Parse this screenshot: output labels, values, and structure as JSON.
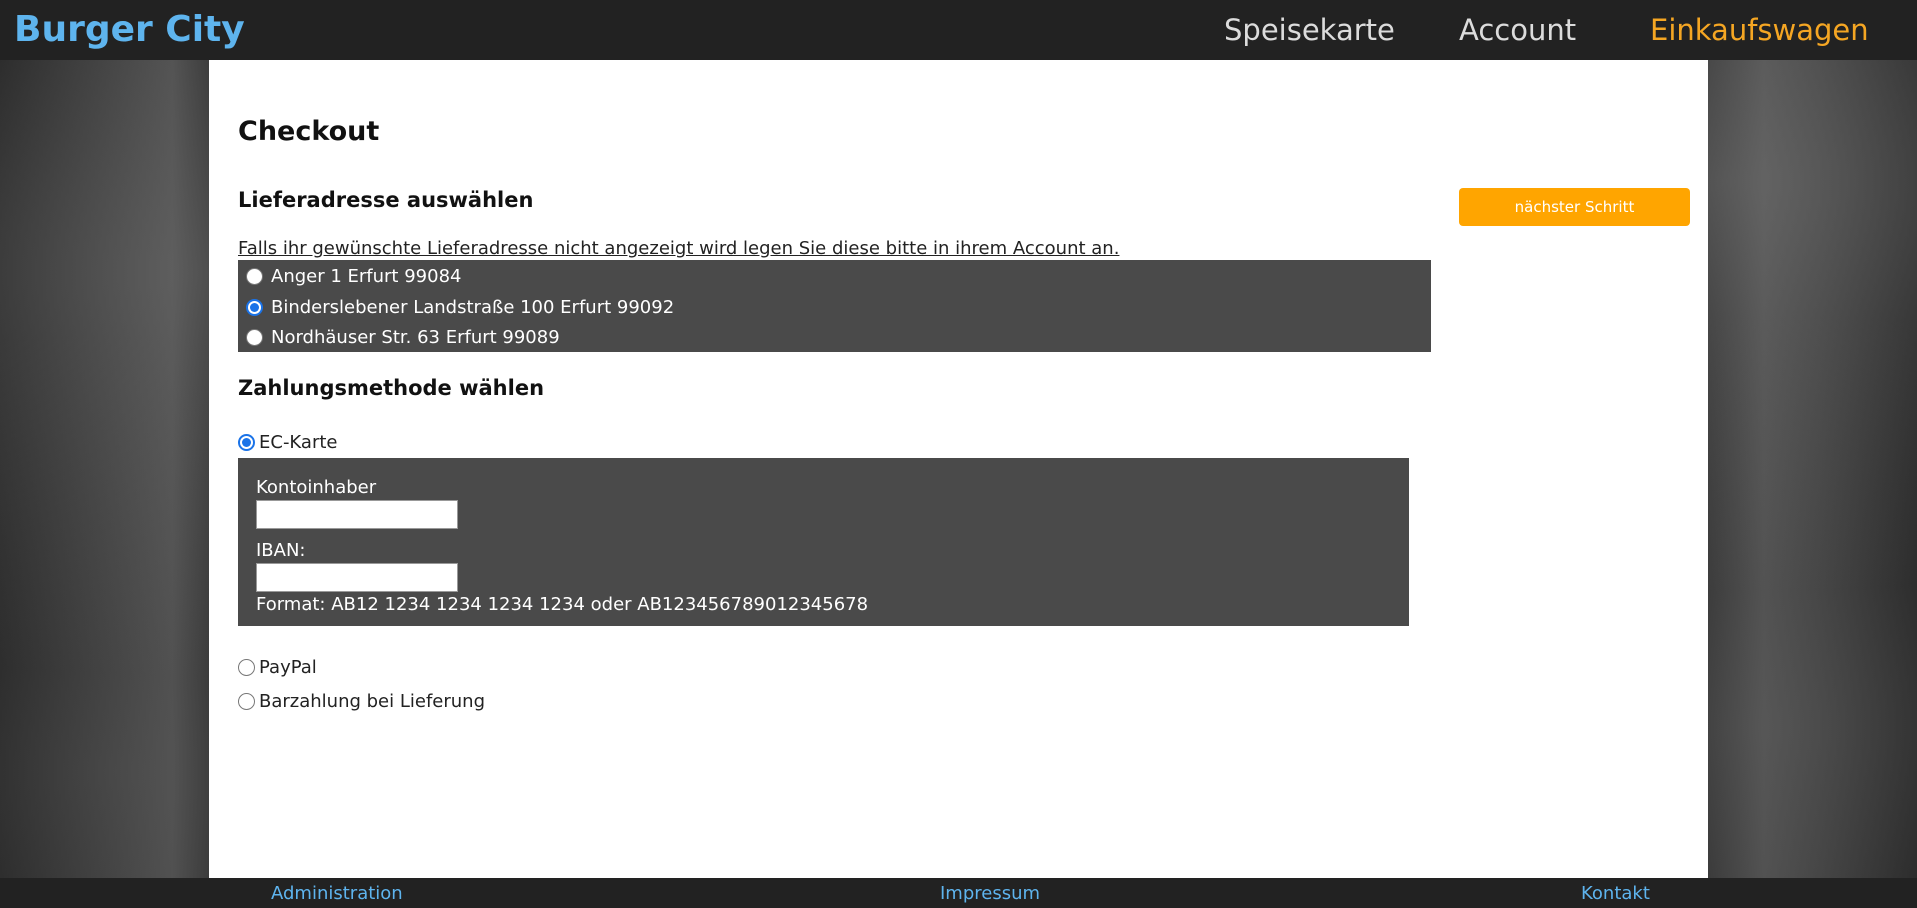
{
  "header": {
    "brand": "Burger City",
    "nav": [
      "Speisekarte",
      "Account",
      "Einkaufswagen"
    ],
    "active_color": "#f5a623",
    "brand_color": "#5eb4ee"
  },
  "main": {
    "title": "Checkout",
    "address_section": {
      "title": "Lieferadresse auswählen",
      "hint": "Falls ihr gewünschte Lieferadresse nicht angezeigt wird legen Sie diese bitte in ihrem Account an.",
      "options": [
        {
          "label": "Anger 1 Erfurt 99084",
          "checked": false
        },
        {
          "label": "Binderslebener Landstraße 100 Erfurt 99092",
          "checked": true
        },
        {
          "label": "Nordhäuser Str. 63 Erfurt 99089",
          "checked": false
        }
      ]
    },
    "payment_section": {
      "title": "Zahlungsmethode wählen",
      "ec_label": "EC-Karte",
      "ec_checked": true,
      "account_holder_label": "Kontoinhaber",
      "account_holder_value": "",
      "iban_label": "IBAN:",
      "iban_value": "",
      "format_hint": "Format: AB12 1234 1234 1234 1234 oder AB123456789012345678",
      "paypal_label": "PayPal",
      "cash_label": "Barzahlung bei Lieferung"
    },
    "next_button": "nächster Schritt",
    "next_button_color": "#ffa500"
  },
  "footer": {
    "links": [
      "Administration",
      "Impressum",
      "Kontakt"
    ]
  }
}
